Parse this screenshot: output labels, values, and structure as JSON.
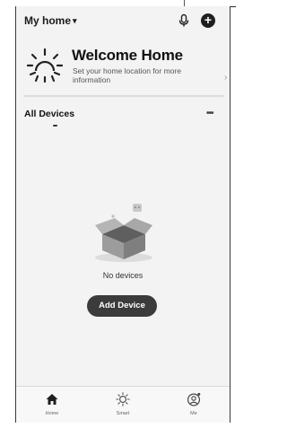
{
  "header": {
    "home_name": "My  home",
    "chevron": "▾",
    "add_symbol": "+",
    "icons": [
      "microphone-icon",
      "add-circle-icon",
      "chevron-down-icon"
    ]
  },
  "welcome": {
    "title": "Welcome Home",
    "subtitle": "Set your home location for more information",
    "arrow": "›",
    "icon": "sun-icon"
  },
  "devices": {
    "tab_label": "All Devices",
    "more": "•••",
    "empty_text": "No devices",
    "add_button": "Add Device",
    "illustration": "empty-box-illustration"
  },
  "tabbar": {
    "items": [
      {
        "label": "Home",
        "icon": "home-icon",
        "active": true
      },
      {
        "label": "Smart",
        "icon": "sun-icon",
        "active": false
      },
      {
        "label": "Me",
        "icon": "profile-icon",
        "active": false
      }
    ]
  },
  "colors": {
    "background": "#f3f3f3",
    "button": "#3b3b3b",
    "text": "#1e1e1e"
  }
}
